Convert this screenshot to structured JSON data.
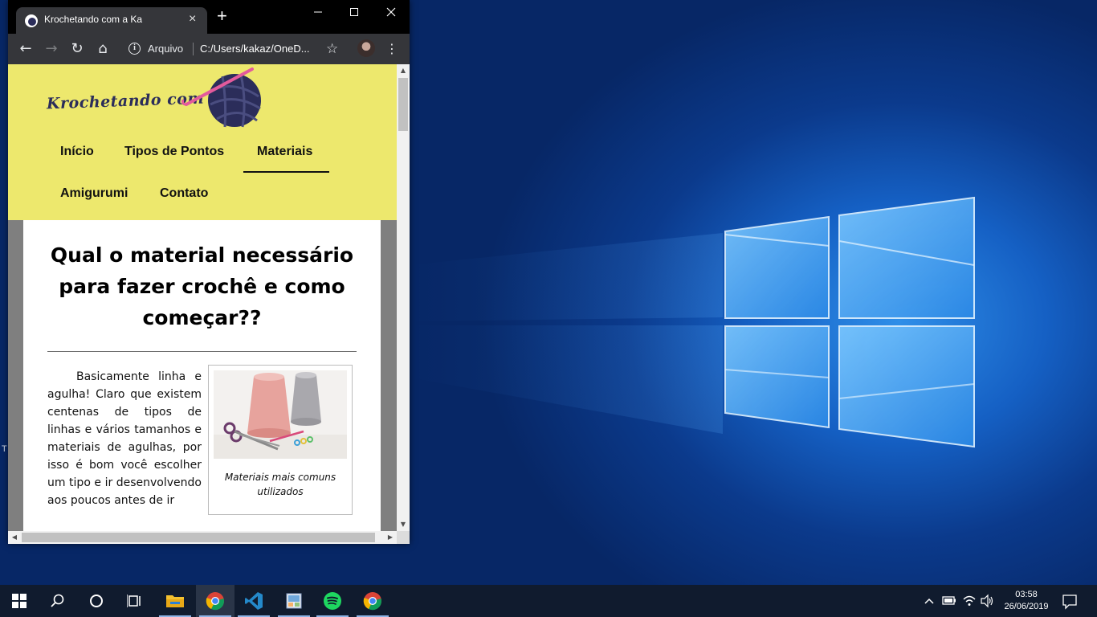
{
  "desktop": {
    "stray_text": "T"
  },
  "browser": {
    "tab": {
      "title": "Krochetando com a Ka",
      "close_icon": "×",
      "new_tab_icon": "+"
    },
    "window_controls": {
      "minimize": "—",
      "maximize": "☐",
      "close": "✕"
    },
    "toolbar": {
      "back_icon": "←",
      "forward_icon": "→",
      "reload_icon": "↻",
      "home_icon": "⌂",
      "info_icon": "i",
      "scheme_label": "Arquivo",
      "url": "C:/Users/kakaz/OneD...",
      "star_icon": "☆",
      "menu_icon": "⋮"
    }
  },
  "site": {
    "logo_text": "Krochetando com a Ka",
    "nav": [
      {
        "label": "Início"
      },
      {
        "label": "Tipos de Pontos"
      },
      {
        "label": "Materiais",
        "active": true
      },
      {
        "label": "Amigurumi"
      },
      {
        "label": "Contato"
      }
    ],
    "article": {
      "title": "Qual o material necessário para fazer crochê e como começar??",
      "body": "Basicamente linha e agulha! Claro que existem centenas de tipos de linhas e vários tamanhos e materiais de agulhas, por isso é bom você escolher um tipo e ir desenvolvendo aos poucos antes de ir",
      "figure_caption": "Materiais mais comuns utilizados"
    },
    "colors": {
      "header_bg": "#ede86d",
      "logo_color": "#2b2d5a",
      "yarn_color": "#2b2d5a",
      "hook_color": "#e35a9c"
    }
  },
  "taskbar": {
    "time": "03:58",
    "date": "26/06/2019",
    "apps": [
      "start-icon",
      "search-icon",
      "cortana-icon",
      "task-view-icon",
      "file-explorer-icon",
      "chrome-icon",
      "vscode-icon",
      "paint-icon",
      "spotify-icon",
      "chrome-icon"
    ]
  }
}
